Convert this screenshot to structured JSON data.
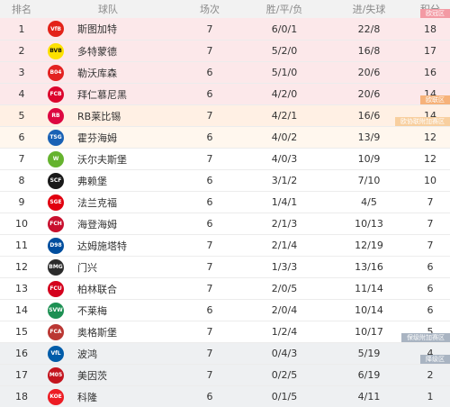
{
  "header": {
    "rank": "排名",
    "team": "球队",
    "played": "场次",
    "wdl": "胜/平/负",
    "goals": "进/失球",
    "points": "积分"
  },
  "zones": {
    "ucl": {
      "label": "欧冠区",
      "color": "#fce8ea",
      "tag_color": "#f39aa4"
    },
    "uel": {
      "label": "欧联区",
      "color": "#fff0e4",
      "tag_color": "#f6b27a"
    },
    "uecl": {
      "label": "欧协联附加赛区",
      "color": "#fff7ee",
      "tag_color": "#f8cf9f"
    },
    "relegation_playoff": {
      "label": "保级附加赛区",
      "color": "#eef0f2",
      "tag_color": "#a9b4c2"
    },
    "relegation": {
      "label": "降级区",
      "color": "#eef0f2",
      "tag_color": "#a9b4c2"
    }
  },
  "teams": [
    {
      "rank": "1",
      "name": "斯图加特",
      "played": "7",
      "wdl": "6/0/1",
      "goals": "22/8",
      "points": "18",
      "logo_icon": "stuttgart-logo-icon",
      "logo_color": "#e32219",
      "logo_text": "VfB",
      "zone": "ucl"
    },
    {
      "rank": "2",
      "name": "多特蒙德",
      "played": "7",
      "wdl": "5/2/0",
      "goals": "16/8",
      "points": "17",
      "logo_icon": "dortmund-logo-icon",
      "logo_color": "#fde100",
      "logo_text": "BVB",
      "zone": "ucl"
    },
    {
      "rank": "3",
      "name": "勒沃库森",
      "played": "6",
      "wdl": "5/1/0",
      "goals": "20/6",
      "points": "16",
      "logo_icon": "leverkusen-logo-icon",
      "logo_color": "#e32221",
      "logo_text": "B04",
      "zone": "ucl"
    },
    {
      "rank": "4",
      "name": "拜仁慕尼黑",
      "played": "6",
      "wdl": "4/2/0",
      "goals": "20/6",
      "points": "14",
      "logo_icon": "bayern-logo-icon",
      "logo_color": "#dc052d",
      "logo_text": "FCB",
      "zone": "ucl"
    },
    {
      "rank": "5",
      "name": "RB莱比锡",
      "played": "7",
      "wdl": "4/2/1",
      "goals": "16/6",
      "points": "14",
      "logo_icon": "leipzig-logo-icon",
      "logo_color": "#dd0741",
      "logo_text": "RB",
      "zone": "uel"
    },
    {
      "rank": "6",
      "name": "霍芬海姆",
      "played": "6",
      "wdl": "4/0/2",
      "goals": "13/9",
      "points": "12",
      "logo_icon": "hoffenheim-logo-icon",
      "logo_color": "#1961b5",
      "logo_text": "TSG",
      "zone": "uecl"
    },
    {
      "rank": "7",
      "name": "沃尔夫斯堡",
      "played": "7",
      "wdl": "4/0/3",
      "goals": "10/9",
      "points": "12",
      "logo_icon": "wolfsburg-logo-icon",
      "logo_color": "#65b32e",
      "logo_text": "W",
      "zone": ""
    },
    {
      "rank": "8",
      "name": "弗赖堡",
      "played": "6",
      "wdl": "3/1/2",
      "goals": "7/10",
      "points": "10",
      "logo_icon": "freiburg-logo-icon",
      "logo_color": "#1a1a1a",
      "logo_text": "SCF",
      "zone": ""
    },
    {
      "rank": "9",
      "name": "法兰克福",
      "played": "6",
      "wdl": "1/4/1",
      "goals": "4/5",
      "points": "7",
      "logo_icon": "frankfurt-logo-icon",
      "logo_color": "#e1000f",
      "logo_text": "SGE",
      "zone": ""
    },
    {
      "rank": "10",
      "name": "海登海姆",
      "played": "6",
      "wdl": "2/1/3",
      "goals": "10/13",
      "points": "7",
      "logo_icon": "heidenheim-logo-icon",
      "logo_color": "#c8102e",
      "logo_text": "FCH",
      "zone": ""
    },
    {
      "rank": "11",
      "name": "达姆施塔特",
      "played": "7",
      "wdl": "2/1/4",
      "goals": "12/19",
      "points": "7",
      "logo_icon": "darmstadt-logo-icon",
      "logo_color": "#004e9e",
      "logo_text": "D98",
      "zone": ""
    },
    {
      "rank": "12",
      "name": "门兴",
      "played": "7",
      "wdl": "1/3/3",
      "goals": "13/16",
      "points": "6",
      "logo_icon": "gladbach-logo-icon",
      "logo_color": "#2b2b2b",
      "logo_text": "BMG",
      "zone": ""
    },
    {
      "rank": "13",
      "name": "柏林联合",
      "played": "7",
      "wdl": "2/0/5",
      "goals": "11/14",
      "points": "6",
      "logo_icon": "union-berlin-logo-icon",
      "logo_color": "#d4011d",
      "logo_text": "FCU",
      "zone": ""
    },
    {
      "rank": "14",
      "name": "不莱梅",
      "played": "6",
      "wdl": "2/0/4",
      "goals": "10/14",
      "points": "6",
      "logo_icon": "bremen-logo-icon",
      "logo_color": "#1d9053",
      "logo_text": "SVW",
      "zone": ""
    },
    {
      "rank": "15",
      "name": "奥格斯堡",
      "played": "7",
      "wdl": "1/2/4",
      "goals": "10/17",
      "points": "5",
      "logo_icon": "augsburg-logo-icon",
      "logo_color": "#ba3733",
      "logo_text": "FCA",
      "zone": ""
    },
    {
      "rank": "16",
      "name": "波鸿",
      "played": "7",
      "wdl": "0/4/3",
      "goals": "5/19",
      "points": "4",
      "logo_icon": "bochum-logo-icon",
      "logo_color": "#005ca9",
      "logo_text": "VfL",
      "zone": "relegation_playoff"
    },
    {
      "rank": "17",
      "name": "美因茨",
      "played": "7",
      "wdl": "0/2/5",
      "goals": "6/19",
      "points": "2",
      "logo_icon": "mainz-logo-icon",
      "logo_color": "#c3141e",
      "logo_text": "M05",
      "zone": "relegation"
    },
    {
      "rank": "18",
      "name": "科隆",
      "played": "6",
      "wdl": "0/1/5",
      "goals": "4/11",
      "points": "1",
      "logo_icon": "koln-logo-icon",
      "logo_color": "#ed1c24",
      "logo_text": "KOE",
      "zone": "relegation"
    }
  ]
}
